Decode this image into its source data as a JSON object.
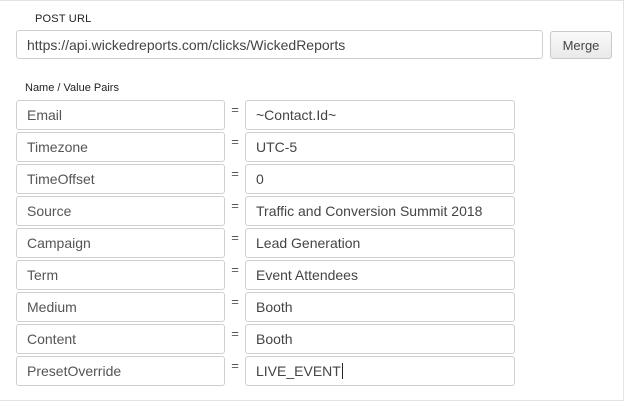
{
  "post_url": {
    "label": "POST URL",
    "value": "https://api.wickedreports.com/clicks/WickedReports",
    "merge_label": "Merge"
  },
  "pairs": {
    "label": "Name / Value Pairs",
    "equals": "=",
    "rows": [
      {
        "name": "Email",
        "value": "~Contact.Id~"
      },
      {
        "name": "Timezone",
        "value": "UTC-5"
      },
      {
        "name": "TimeOffset",
        "value": "0"
      },
      {
        "name": "Source",
        "value": "Traffic and Conversion Summit 2018"
      },
      {
        "name": "Campaign",
        "value": "Lead Generation"
      },
      {
        "name": "Term",
        "value": "Event Attendees"
      },
      {
        "name": "Medium",
        "value": "Booth"
      },
      {
        "name": "Content",
        "value": "Booth"
      },
      {
        "name": "PresetOverride",
        "value": "LIVE_EVENT"
      }
    ]
  }
}
